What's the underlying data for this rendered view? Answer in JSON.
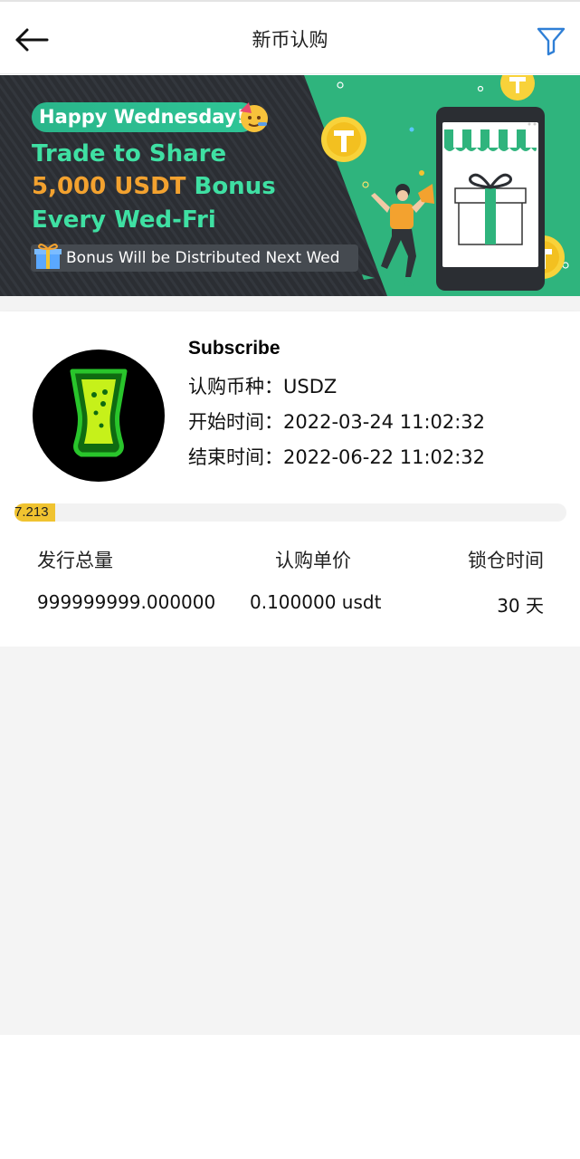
{
  "header": {
    "title": "新币认购",
    "back_icon": "arrow-left-icon",
    "filter_icon": "filter-icon"
  },
  "banner": {
    "greeting": "Happy Wednesday!",
    "line1": "Trade to Share",
    "line2_highlight": "5,000 USDT",
    "line2_tail": " Bonus",
    "line3": "Every Wed-Fri",
    "note": "Bonus Will be Distributed Next Wed",
    "colors": {
      "green": "#2fb47d",
      "dark": "#2a2d31",
      "orange": "#f3a22f",
      "mint": "#3fe0a3"
    }
  },
  "subscription": {
    "title": "Subscribe",
    "coin_label": "认购币种：",
    "coin": "USDZ",
    "start_label": "开始时间：",
    "start_time": "2022-03-24 11:02:32",
    "end_label": "结束时间：",
    "end_time": "2022-06-22 11:02:32",
    "progress_text": "7.213",
    "progress_percent": 7.213,
    "progress_color": "#f0c330"
  },
  "stats": {
    "headers": [
      "发行总量",
      "认购单价",
      "锁仓时间"
    ],
    "values": [
      "999999999.000000",
      "0.100000 usdt",
      "30 天"
    ]
  }
}
